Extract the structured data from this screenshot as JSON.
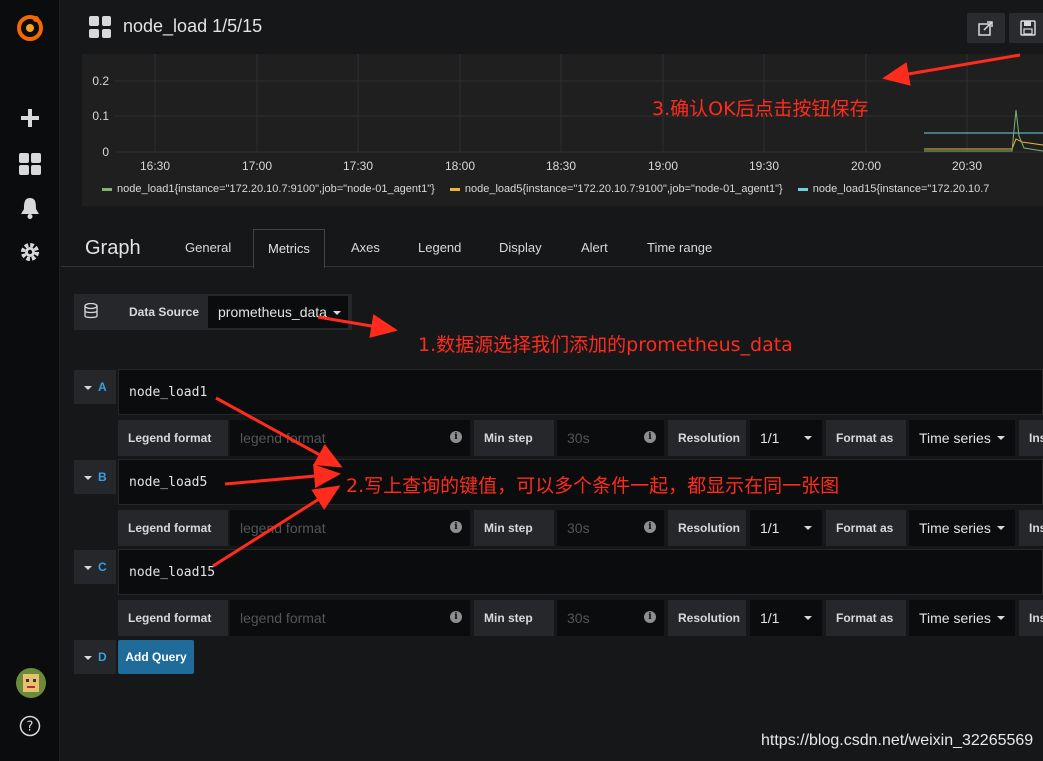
{
  "topbar": {
    "title": "node_load 1/5/15"
  },
  "graph": {
    "y_ticks": [
      "0.2",
      "0.1",
      "0"
    ],
    "x_ticks": [
      "16:30",
      "17:00",
      "17:30",
      "18:00",
      "18:30",
      "19:00",
      "19:30",
      "20:00",
      "20:30"
    ],
    "legend": [
      {
        "label": "node_load1{instance=\"172.20.10.7:9100\",job=\"node-01_agent1\"}",
        "color": "#7eb26d"
      },
      {
        "label": "node_load5{instance=\"172.20.10.7:9100\",job=\"node-01_agent1\"}",
        "color": "#eab839"
      },
      {
        "label": "node_load15{instance=\"172.20.10.7",
        "color": "#6ed0e0"
      }
    ]
  },
  "editor": {
    "title": "Graph",
    "tabs": [
      "General",
      "Metrics",
      "Axes",
      "Legend",
      "Display",
      "Alert",
      "Time range"
    ],
    "active_tab": "Metrics"
  },
  "datasource": {
    "label": "Data Source",
    "value": "prometheus_data"
  },
  "queries": [
    {
      "letter": "A",
      "expr": "node_load1"
    },
    {
      "letter": "B",
      "expr": "node_load5"
    },
    {
      "letter": "C",
      "expr": "node_load15"
    }
  ],
  "query_options": {
    "legend_label": "Legend format",
    "legend_placeholder": "legend format",
    "minstep_label": "Min step",
    "minstep_placeholder": "30s",
    "resolution_label": "Resolution",
    "resolution_value": "1/1",
    "format_label": "Format as",
    "format_value": "Time series",
    "instant_label": "Ins"
  },
  "add_query": {
    "letter": "D",
    "label": "Add Query"
  },
  "annotations": {
    "step1": "1.数据源选择我们添加的prometheus_data",
    "step2": "2.写上查询的键值，可以多个条件一起，都显示在同一张图",
    "step3": "3.确认OK后点击按钮保存"
  },
  "watermark": "https://blog.csdn.net/weixin_32265569"
}
